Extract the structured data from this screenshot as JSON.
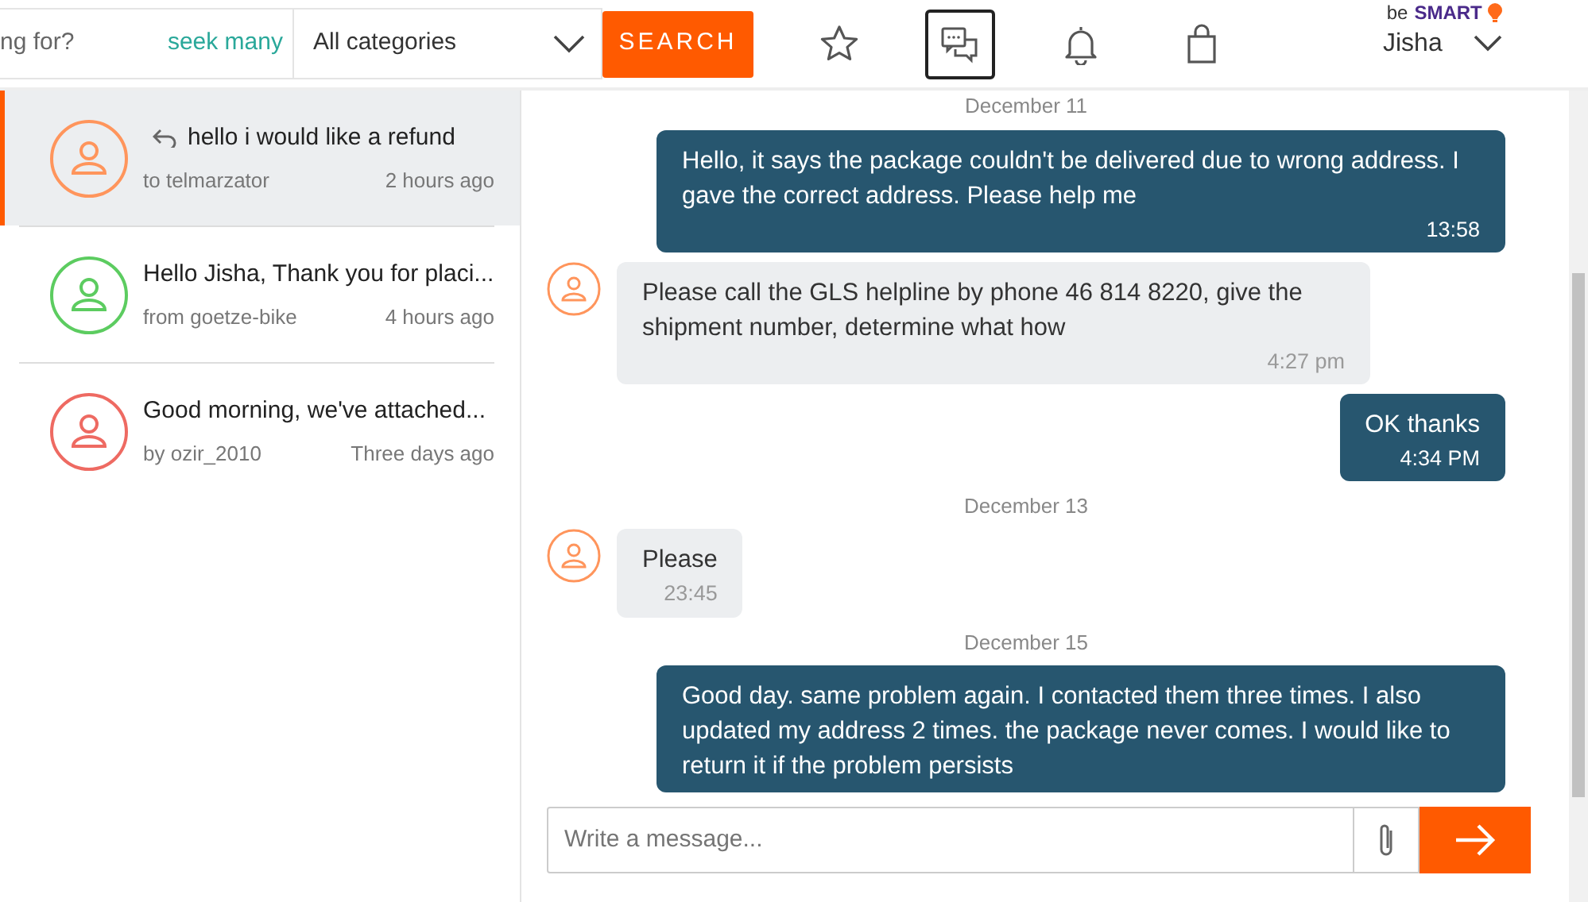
{
  "header": {
    "search": {
      "placeholder": "ng for?"
    },
    "seek_link": "seek many",
    "category": "All categories",
    "search_button": "SEARCH",
    "icons": [
      {
        "kind": "star",
        "selected": false
      },
      {
        "kind": "messages",
        "selected": true
      },
      {
        "kind": "bell",
        "selected": false
      },
      {
        "kind": "bag",
        "selected": false
      }
    ],
    "brand": {
      "prefix": "be",
      "name": "SMART"
    },
    "user": "Jisha"
  },
  "conversations": [
    {
      "title": "hello i would like a refund",
      "replied": true,
      "meta": "to telmarzator",
      "time": "2 hours ago",
      "color": "#ff955c",
      "selected": true
    },
    {
      "title": "Hello Jisha, Thank you for placi...",
      "replied": false,
      "meta": "from goetze-bike",
      "time": "4 hours ago",
      "color": "#5ccc60",
      "selected": false
    },
    {
      "title": "Good morning, we've attached...",
      "replied": false,
      "meta": "by ozir_2010",
      "time": "Three days ago",
      "color": "#ee6a62",
      "selected": false
    }
  ],
  "messages": [
    {
      "kind": "date",
      "text": "December 11"
    },
    {
      "kind": "out",
      "text": "Hello, it says the package couldn't be delivered due to wrong address. I gave the correct address. Please help me",
      "time": "13:58"
    },
    {
      "kind": "in",
      "text": "Please call the GLS helpline by phone 46 814 8220, give the shipment number, determine what how",
      "time": "4:27 pm"
    },
    {
      "kind": "out",
      "text": "OK thanks",
      "time": "4:34 PM"
    },
    {
      "kind": "date",
      "text": "December 13"
    },
    {
      "kind": "in",
      "text": "Please",
      "time": "23:45"
    },
    {
      "kind": "date",
      "text": "December 15"
    },
    {
      "kind": "out",
      "text": "Good day. same problem again. I contacted them three times. I also updated my address 2 times. the package never comes. I would like to return it if the problem persists"
    }
  ],
  "composer": {
    "placeholder": "Write a message..."
  }
}
